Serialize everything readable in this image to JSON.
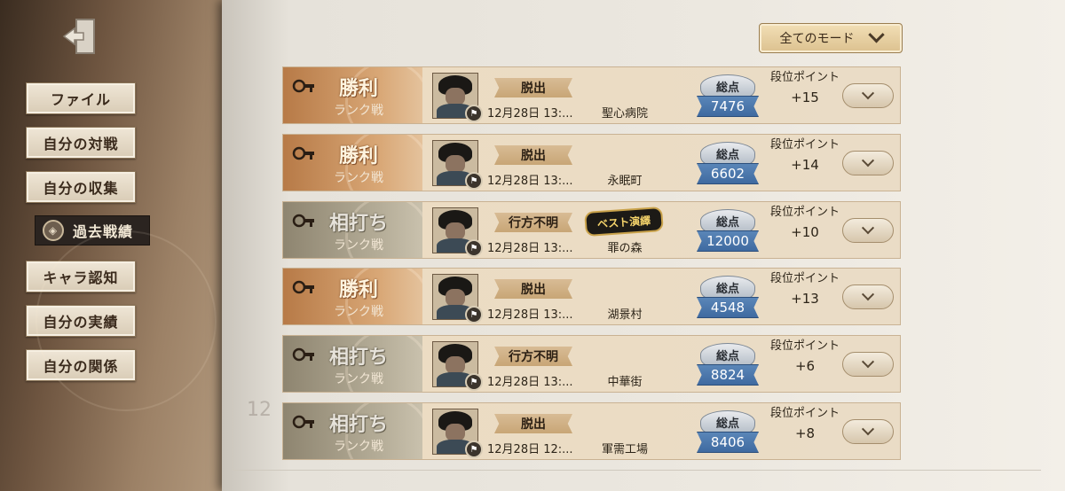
{
  "sidebar": {
    "items": [
      {
        "label": "ファイル",
        "active": false
      },
      {
        "label": "自分の対戦",
        "active": false
      },
      {
        "label": "自分の収集",
        "active": false
      },
      {
        "label": "過去戦績",
        "active": true
      },
      {
        "label": "キャラ認知",
        "active": false
      },
      {
        "label": "自分の実績",
        "active": false
      },
      {
        "label": "自分の関係",
        "active": false
      }
    ]
  },
  "filter": {
    "mode_label": "全てのモード"
  },
  "page_marker": "12",
  "matches": [
    {
      "result": "勝利",
      "result_type": "win",
      "mode": "ランク戦",
      "outcome": "脱出",
      "best": "",
      "date": "12月28日 13:...",
      "map": "聖心病院",
      "score_label": "総点",
      "score": "7476",
      "rank_label": "段位ポイント",
      "rank_points": "+15"
    },
    {
      "result": "勝利",
      "result_type": "win",
      "mode": "ランク戦",
      "outcome": "脱出",
      "best": "",
      "date": "12月28日 13:...",
      "map": "永眠町",
      "score_label": "総点",
      "score": "6602",
      "rank_label": "段位ポイント",
      "rank_points": "+14"
    },
    {
      "result": "相打ち",
      "result_type": "draw",
      "mode": "ランク戦",
      "outcome": "行方不明",
      "best": "ベスト演繹",
      "date": "12月28日 13:...",
      "map": "罪の森",
      "score_label": "総点",
      "score": "12000",
      "rank_label": "段位ポイント",
      "rank_points": "+10"
    },
    {
      "result": "勝利",
      "result_type": "win",
      "mode": "ランク戦",
      "outcome": "脱出",
      "best": "",
      "date": "12月28日 13:...",
      "map": "湖景村",
      "score_label": "総点",
      "score": "4548",
      "rank_label": "段位ポイント",
      "rank_points": "+13"
    },
    {
      "result": "相打ち",
      "result_type": "draw",
      "mode": "ランク戦",
      "outcome": "行方不明",
      "best": "",
      "date": "12月28日 13:...",
      "map": "中華街",
      "score_label": "総点",
      "score": "8824",
      "rank_label": "段位ポイント",
      "rank_points": "+6"
    },
    {
      "result": "相打ち",
      "result_type": "draw",
      "mode": "ランク戦",
      "outcome": "脱出",
      "best": "",
      "date": "12月28日 12:...",
      "map": "軍需工場",
      "score_label": "総点",
      "score": "8406",
      "rank_label": "段位ポイント",
      "rank_points": "+8"
    }
  ]
}
